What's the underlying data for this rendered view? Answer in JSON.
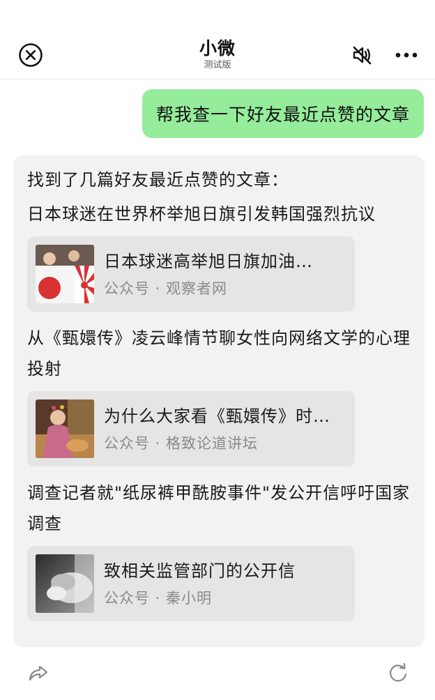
{
  "header": {
    "title": "小微",
    "subtitle": "测试版",
    "close_icon": "close-circle-icon",
    "mute_icon": "speaker-muted-icon",
    "more_icon": "more-dots-icon"
  },
  "user_message": "帮我查一下好友最近点赞的文章",
  "reply": {
    "intro": "找到了几篇好友最近点赞的文章：",
    "articles": [
      {
        "title": "日本球迷在世界杯举旭日旗引发韩国强烈抗议",
        "card_title": "日本球迷高举旭日旗加油…",
        "source": "公众号 · 观察者网"
      },
      {
        "title": "从《甄嬛传》凌云峰情节聊女性向网络文学的心理投射",
        "card_title": "为什么大家看《甄嬛传》时…",
        "source": "公众号 · 格致论道讲坛"
      },
      {
        "title": "调查记者就\"纸尿裤甲酰胺事件\"发公开信呼吁国家调查",
        "card_title": "致相关监管部门的公开信",
        "source": "公众号 · 秦小明"
      }
    ]
  },
  "footer": {
    "share_icon": "share-forward-icon",
    "refresh_icon": "refresh-icon"
  },
  "colors": {
    "user_bubble": "#95ec9b",
    "reply_background": "#f2f2f2",
    "card_background": "#e5e5e5",
    "source_text": "#8a8a8a"
  }
}
